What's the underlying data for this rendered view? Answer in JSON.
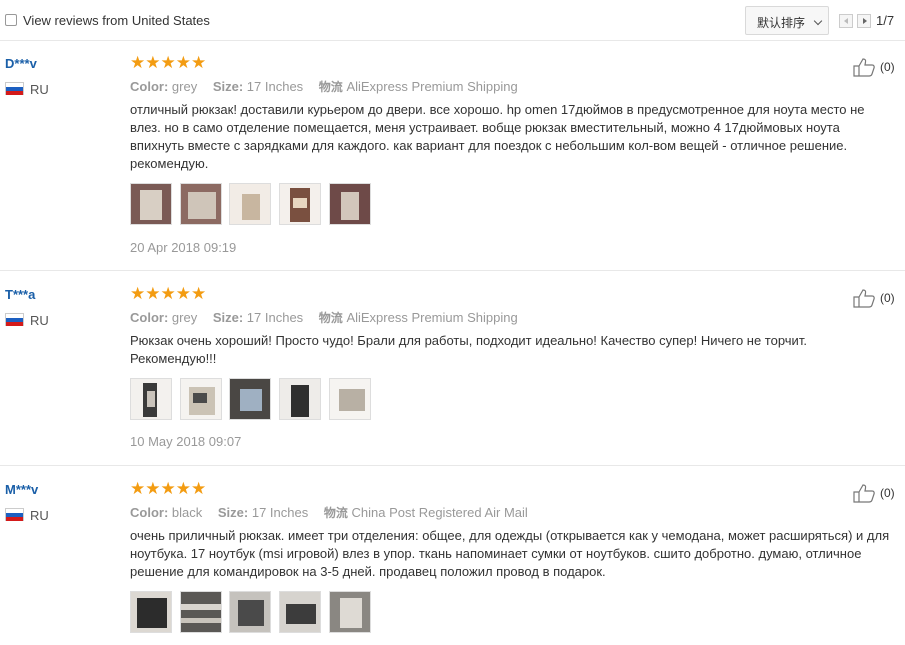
{
  "toolbar": {
    "filter_label": "View reviews from United States",
    "sort_label": "默认排序",
    "page_indicator": "1/7"
  },
  "labels": {
    "color": "Color:",
    "size": "Size:",
    "shipping": "物流"
  },
  "reviews": [
    {
      "user": "D***v",
      "country": "RU",
      "rating": 5,
      "stars": "★★★★★",
      "color": "grey",
      "size": "17 Inches",
      "shipping": "AliExpress Premium Shipping",
      "text": "отличный рюкзак! доставили курьером до двери. все хорошо. hp omen 17дюймов в предусмотренное для ноута место не влез. но в само отделение помещается, меня устраивает. вобще рюкзак вместительный, можно 4 17дюймовых ноута впихнуть вместе с зарядками для каждого. как вариант для поездок с небольшим кол-вом вещей - отличное решение. рекомендую.",
      "photo_count": 5,
      "date": "20 Apr 2018 09:19",
      "likes": "(0)"
    },
    {
      "user": "T***a",
      "country": "RU",
      "rating": 5,
      "stars": "★★★★★",
      "color": "grey",
      "size": "17 Inches",
      "shipping": "AliExpress Premium Shipping",
      "text": "Рюкзак очень хороший! Просто чудо! Брали для работы, подходит идеально! Качество супер! Ничего не торчит. Рекомендую!!!",
      "photo_count": 5,
      "date": "10 May 2018 09:07",
      "likes": "(0)"
    },
    {
      "user": "M***v",
      "country": "RU",
      "rating": 5,
      "stars": "★★★★★",
      "color": "black",
      "size": "17 Inches",
      "shipping": "China Post Registered Air Mail",
      "text": "очень приличный рюкзак. имеет три отделения: общее, для одежды (открывается как у чемодана, может расширяться) и для ноутбука. 17 ноутбук (msi игровой) влез в упор. ткань напоминает сумки от ноутбуков. сшито добротно. думаю, отличное решение для командировок на 3-5 дней. продавец положил провод в подарок.",
      "photo_count": 5,
      "date": "",
      "likes": "(0)"
    }
  ],
  "colors": {
    "username": "#1a5fa8",
    "star": "#f39c12",
    "muted": "#999999"
  },
  "icons": {
    "like": "thumbs-up-icon",
    "flag": "russia-flag-icon"
  }
}
